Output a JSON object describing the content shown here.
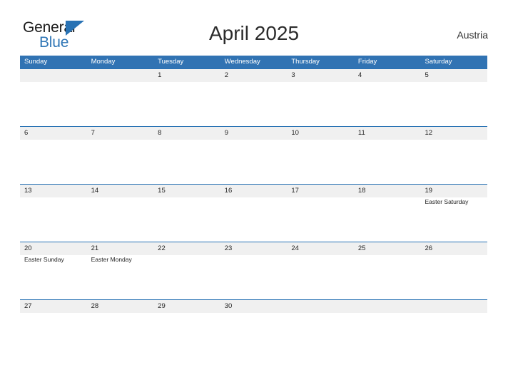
{
  "brand": {
    "name_part1": "General",
    "name_part2": "Blue",
    "flag_icon": "blue-flag-icon"
  },
  "header": {
    "title": "April 2025",
    "country": "Austria"
  },
  "colors": {
    "header_blue": "#3173b3",
    "row_rule_blue": "#2872b4",
    "band_gray": "#f0f0f0",
    "brand_blue": "#2f76b6",
    "text_dark": "#242424"
  },
  "calendar": {
    "weekdays": [
      "Sunday",
      "Monday",
      "Tuesday",
      "Wednesday",
      "Thursday",
      "Friday",
      "Saturday"
    ],
    "weeks": [
      [
        {
          "day": "",
          "event": ""
        },
        {
          "day": "",
          "event": ""
        },
        {
          "day": "1",
          "event": ""
        },
        {
          "day": "2",
          "event": ""
        },
        {
          "day": "3",
          "event": ""
        },
        {
          "day": "4",
          "event": ""
        },
        {
          "day": "5",
          "event": ""
        }
      ],
      [
        {
          "day": "6",
          "event": ""
        },
        {
          "day": "7",
          "event": ""
        },
        {
          "day": "8",
          "event": ""
        },
        {
          "day": "9",
          "event": ""
        },
        {
          "day": "10",
          "event": ""
        },
        {
          "day": "11",
          "event": ""
        },
        {
          "day": "12",
          "event": ""
        }
      ],
      [
        {
          "day": "13",
          "event": ""
        },
        {
          "day": "14",
          "event": ""
        },
        {
          "day": "15",
          "event": ""
        },
        {
          "day": "16",
          "event": ""
        },
        {
          "day": "17",
          "event": ""
        },
        {
          "day": "18",
          "event": ""
        },
        {
          "day": "19",
          "event": "Easter Saturday"
        }
      ],
      [
        {
          "day": "20",
          "event": "Easter Sunday"
        },
        {
          "day": "21",
          "event": "Easter Monday"
        },
        {
          "day": "22",
          "event": ""
        },
        {
          "day": "23",
          "event": ""
        },
        {
          "day": "24",
          "event": ""
        },
        {
          "day": "25",
          "event": ""
        },
        {
          "day": "26",
          "event": ""
        }
      ],
      [
        {
          "day": "27",
          "event": ""
        },
        {
          "day": "28",
          "event": ""
        },
        {
          "day": "29",
          "event": ""
        },
        {
          "day": "30",
          "event": ""
        },
        {
          "day": "",
          "event": ""
        },
        {
          "day": "",
          "event": ""
        },
        {
          "day": "",
          "event": ""
        }
      ]
    ]
  }
}
